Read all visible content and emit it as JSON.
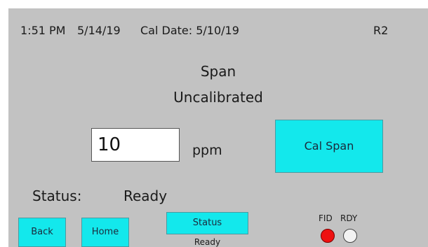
{
  "header": {
    "time": "1:51 PM",
    "date": "5/14/19",
    "cal_date": "Cal Date: 5/10/19",
    "revision": "R2"
  },
  "main": {
    "title": "Span",
    "calibration_state": "Uncalibrated",
    "input": {
      "value": "10",
      "unit": "ppm"
    },
    "cal_span_label": "Cal Span"
  },
  "status": {
    "label": "Status:",
    "value": "Ready"
  },
  "footer": {
    "back_label": "Back",
    "home_label": "Home",
    "status_button_label": "Status",
    "status_text": "Ready",
    "indicators": {
      "fid_label": "FID",
      "rdy_label": "RDY",
      "fid_color": "#ee1111",
      "rdy_color": "#f2f2f2"
    }
  },
  "colors": {
    "screen_background": "#c2c2c2",
    "button_accent": "#13e8ec"
  }
}
